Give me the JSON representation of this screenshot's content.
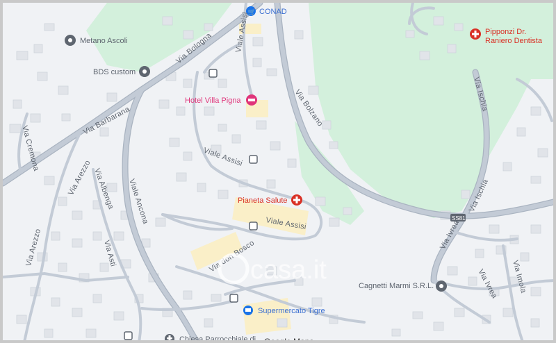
{
  "map": {
    "streets": {
      "via_bologna": "Via Bologna",
      "viale_assisi_top": "Viale Assisi",
      "via_bolzano": "Via Bolzano",
      "via_ischia": "Via Ischia",
      "via_barbarana": "Via Barbarana",
      "via_cremona": "Via Cremona",
      "viale_assisi_mid": "Viale Assisi",
      "via_arezzo_1": "Via Arezzo",
      "via_albenga": "Via Albenga",
      "viale_ancona": "Viale Ancona",
      "via_ischia_2": "Via Ischia",
      "ss81": "SS81",
      "via_ivrea_1": "Via Ivrea",
      "viale_assisi_low": "Viale Assisi",
      "via_arezzo_2": "Via Arezzo",
      "via_asti": "Via Asti",
      "via_don_bosco": "Via don Bosco",
      "via_imola": "Via Imola",
      "via_ivrea_2": "Via Ivrea"
    },
    "pois": {
      "conad": "CONAD",
      "metano_ascoli": "Metano Ascoli",
      "bds_custom": "BDS custom",
      "hotel_villa_pigna": "Hotel Villa Pigna",
      "pipponzi_line1": "Pipponzi Dr.",
      "pipponzi_line2": "Raniero Dentista",
      "pianeta_salute": "Pianeta Salute",
      "cagnetti_marmi": "Cagnetti Marmi S.R.L.",
      "supermercato_tigre": "Supermercato Tigre",
      "chiesa": "Chiesa Parrocchiale di"
    },
    "watermark": "casa.it",
    "credit": "Google Maps"
  },
  "colors": {
    "background": "#f0f2f5",
    "green_area": "#d3f0dc",
    "road": "#c3cbd6",
    "road_casing": "#aab4c1",
    "building": "#e1e4e9",
    "building_stroke": "#cfd4db",
    "highlight_block": "#faefc8",
    "pink_poi": "#e0347a",
    "red_poi": "#d93025",
    "blue_poi": "#1a73e8"
  }
}
